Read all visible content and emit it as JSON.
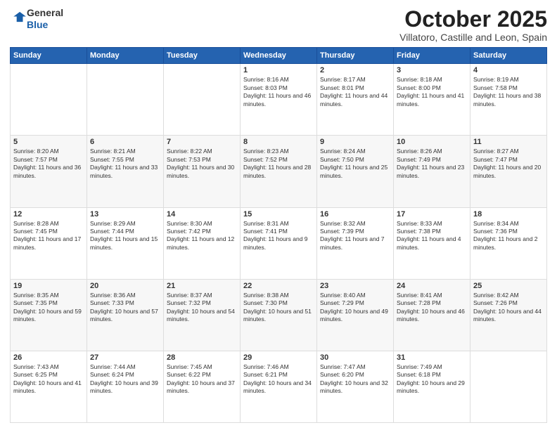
{
  "header": {
    "logo_general": "General",
    "logo_blue": "Blue",
    "month": "October 2025",
    "location": "Villatoro, Castille and Leon, Spain"
  },
  "days_of_week": [
    "Sunday",
    "Monday",
    "Tuesday",
    "Wednesday",
    "Thursday",
    "Friday",
    "Saturday"
  ],
  "weeks": [
    [
      {
        "day": "",
        "content": ""
      },
      {
        "day": "",
        "content": ""
      },
      {
        "day": "",
        "content": ""
      },
      {
        "day": "1",
        "content": "Sunrise: 8:16 AM\nSunset: 8:03 PM\nDaylight: 11 hours and 46 minutes."
      },
      {
        "day": "2",
        "content": "Sunrise: 8:17 AM\nSunset: 8:01 PM\nDaylight: 11 hours and 44 minutes."
      },
      {
        "day": "3",
        "content": "Sunrise: 8:18 AM\nSunset: 8:00 PM\nDaylight: 11 hours and 41 minutes."
      },
      {
        "day": "4",
        "content": "Sunrise: 8:19 AM\nSunset: 7:58 PM\nDaylight: 11 hours and 38 minutes."
      }
    ],
    [
      {
        "day": "5",
        "content": "Sunrise: 8:20 AM\nSunset: 7:57 PM\nDaylight: 11 hours and 36 minutes."
      },
      {
        "day": "6",
        "content": "Sunrise: 8:21 AM\nSunset: 7:55 PM\nDaylight: 11 hours and 33 minutes."
      },
      {
        "day": "7",
        "content": "Sunrise: 8:22 AM\nSunset: 7:53 PM\nDaylight: 11 hours and 30 minutes."
      },
      {
        "day": "8",
        "content": "Sunrise: 8:23 AM\nSunset: 7:52 PM\nDaylight: 11 hours and 28 minutes."
      },
      {
        "day": "9",
        "content": "Sunrise: 8:24 AM\nSunset: 7:50 PM\nDaylight: 11 hours and 25 minutes."
      },
      {
        "day": "10",
        "content": "Sunrise: 8:26 AM\nSunset: 7:49 PM\nDaylight: 11 hours and 23 minutes."
      },
      {
        "day": "11",
        "content": "Sunrise: 8:27 AM\nSunset: 7:47 PM\nDaylight: 11 hours and 20 minutes."
      }
    ],
    [
      {
        "day": "12",
        "content": "Sunrise: 8:28 AM\nSunset: 7:45 PM\nDaylight: 11 hours and 17 minutes."
      },
      {
        "day": "13",
        "content": "Sunrise: 8:29 AM\nSunset: 7:44 PM\nDaylight: 11 hours and 15 minutes."
      },
      {
        "day": "14",
        "content": "Sunrise: 8:30 AM\nSunset: 7:42 PM\nDaylight: 11 hours and 12 minutes."
      },
      {
        "day": "15",
        "content": "Sunrise: 8:31 AM\nSunset: 7:41 PM\nDaylight: 11 hours and 9 minutes."
      },
      {
        "day": "16",
        "content": "Sunrise: 8:32 AM\nSunset: 7:39 PM\nDaylight: 11 hours and 7 minutes."
      },
      {
        "day": "17",
        "content": "Sunrise: 8:33 AM\nSunset: 7:38 PM\nDaylight: 11 hours and 4 minutes."
      },
      {
        "day": "18",
        "content": "Sunrise: 8:34 AM\nSunset: 7:36 PM\nDaylight: 11 hours and 2 minutes."
      }
    ],
    [
      {
        "day": "19",
        "content": "Sunrise: 8:35 AM\nSunset: 7:35 PM\nDaylight: 10 hours and 59 minutes."
      },
      {
        "day": "20",
        "content": "Sunrise: 8:36 AM\nSunset: 7:33 PM\nDaylight: 10 hours and 57 minutes."
      },
      {
        "day": "21",
        "content": "Sunrise: 8:37 AM\nSunset: 7:32 PM\nDaylight: 10 hours and 54 minutes."
      },
      {
        "day": "22",
        "content": "Sunrise: 8:38 AM\nSunset: 7:30 PM\nDaylight: 10 hours and 51 minutes."
      },
      {
        "day": "23",
        "content": "Sunrise: 8:40 AM\nSunset: 7:29 PM\nDaylight: 10 hours and 49 minutes."
      },
      {
        "day": "24",
        "content": "Sunrise: 8:41 AM\nSunset: 7:28 PM\nDaylight: 10 hours and 46 minutes."
      },
      {
        "day": "25",
        "content": "Sunrise: 8:42 AM\nSunset: 7:26 PM\nDaylight: 10 hours and 44 minutes."
      }
    ],
    [
      {
        "day": "26",
        "content": "Sunrise: 7:43 AM\nSunset: 6:25 PM\nDaylight: 10 hours and 41 minutes."
      },
      {
        "day": "27",
        "content": "Sunrise: 7:44 AM\nSunset: 6:24 PM\nDaylight: 10 hours and 39 minutes."
      },
      {
        "day": "28",
        "content": "Sunrise: 7:45 AM\nSunset: 6:22 PM\nDaylight: 10 hours and 37 minutes."
      },
      {
        "day": "29",
        "content": "Sunrise: 7:46 AM\nSunset: 6:21 PM\nDaylight: 10 hours and 34 minutes."
      },
      {
        "day": "30",
        "content": "Sunrise: 7:47 AM\nSunset: 6:20 PM\nDaylight: 10 hours and 32 minutes."
      },
      {
        "day": "31",
        "content": "Sunrise: 7:49 AM\nSunset: 6:18 PM\nDaylight: 10 hours and 29 minutes."
      },
      {
        "day": "",
        "content": ""
      }
    ]
  ]
}
